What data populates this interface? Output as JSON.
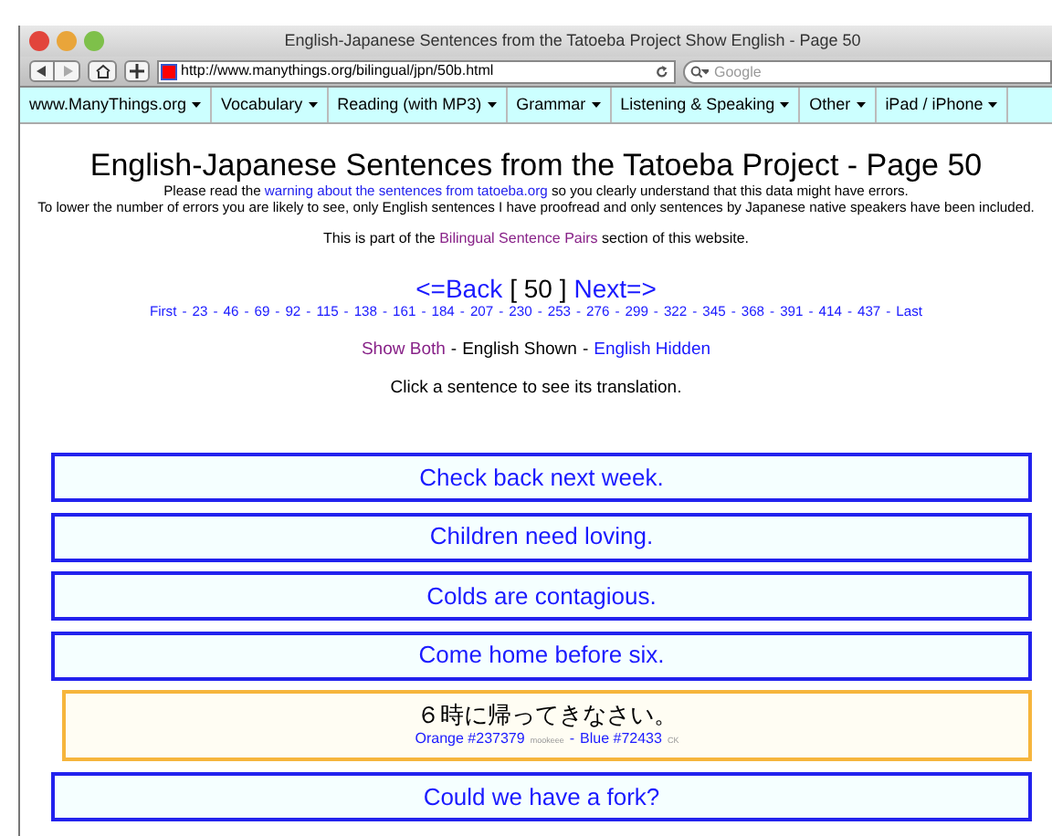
{
  "window": {
    "title": "English-Japanese Sentences from the Tatoeba Project Show English - Page 50",
    "url": "http://www.manythings.org/bilingual/jpn/50b.html",
    "search_placeholder": "Google"
  },
  "nav_menu": [
    {
      "label": "www.ManyThings.org"
    },
    {
      "label": "Vocabulary"
    },
    {
      "label": "Reading (with MP3)"
    },
    {
      "label": "Grammar"
    },
    {
      "label": "Listening & Speaking"
    },
    {
      "label": "Other"
    },
    {
      "label": "iPad / iPhone"
    }
  ],
  "page": {
    "heading": "English-Japanese Sentences from the Tatoeba Project - Page 50",
    "notices": [
      [
        {
          "text": "Please read the ",
          "link": false
        },
        {
          "text": "warning about the sentences from tatoeba.org",
          "link": true
        },
        {
          "text": " so you clearly understand that this data might have errors.",
          "link": false
        }
      ],
      [
        {
          "text": "To lower the number of errors you are likely to see, only English sentences I have proofread and only sentences by Japanese native speakers have been included.",
          "link": false
        }
      ]
    ],
    "section_note": [
      {
        "text": "This is part of the ",
        "link": false
      },
      {
        "text": "Bilingual Sentence Pairs",
        "link": true
      },
      {
        "text": " section of this website.",
        "link": false
      }
    ],
    "pager": {
      "back": "<=Back",
      "current": "[ 50 ]",
      "next": "Next=>",
      "separator": "-",
      "page_links": [
        "First",
        "23",
        "46",
        "69",
        "92",
        "115",
        "138",
        "161",
        "184",
        "207",
        "230",
        "253",
        "276",
        "299",
        "322",
        "345",
        "368",
        "391",
        "414",
        "437",
        "Last"
      ]
    },
    "view_modes": {
      "separator": "-",
      "items": [
        {
          "label": "Show Both",
          "selected": false,
          "visited": true
        },
        {
          "label": "English Shown",
          "selected": true,
          "visited": false
        },
        {
          "label": "English Hidden",
          "selected": false,
          "visited": false
        }
      ]
    },
    "instruction": "Click a sentence to see its translation.",
    "sentences": [
      {
        "kind": "english",
        "text": "Check back next week."
      },
      {
        "kind": "english",
        "text": "Children need loving."
      },
      {
        "kind": "english",
        "text": "Colds are contagious."
      },
      {
        "kind": "english",
        "text": "Come home before six."
      },
      {
        "kind": "translation",
        "text": "６時に帰ってきなさい。",
        "separator": "-",
        "sources": [
          {
            "label": "Orange #237379",
            "user": "mookeee"
          },
          {
            "label": "Blue #72433",
            "user": "CK"
          }
        ]
      },
      {
        "kind": "english",
        "text": "Could we have a fork?"
      }
    ]
  }
}
